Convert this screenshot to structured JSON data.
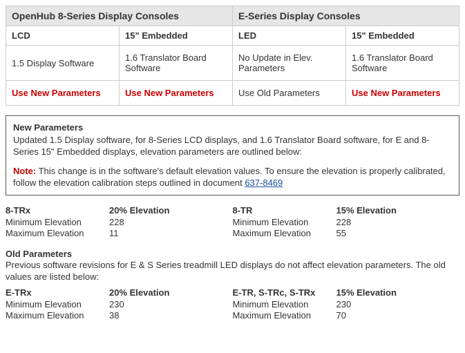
{
  "table": {
    "groupHeaders": [
      "OpenHub 8-Series Display Consoles",
      "E-Series Display Consoles"
    ],
    "subHeaders": [
      "LCD",
      "15\" Embedded",
      "LED",
      "15\" Embedded"
    ],
    "row1": [
      "1.5 Display Software",
      "1.6 Translator Board Software",
      "No Update in Elev. Parameters",
      "1.6 Translator Board Software"
    ],
    "row2": [
      "Use New Parameters",
      "Use New Parameters",
      "Use Old Parameters",
      "Use New Parameters"
    ],
    "row2Red": [
      true,
      true,
      false,
      true
    ]
  },
  "noteBox": {
    "title": "New Parameters",
    "body": "Updated 1.5 Display software, for 8-Series LCD displays, and 1.6 Translator Board software, for E and 8-Series 15\" Embedded displays, elevation parameters are outlined below:",
    "noteLabel": "Note:",
    "noteText": " This change is in the software's default elevation values. To ensure the elevation is properly calibrated, follow the elevation calibration steps outlined in document ",
    "link": "637-8469"
  },
  "newParams": {
    "left": {
      "name": "8-TRx",
      "elev": "20% Elevation",
      "minLabel": "Minimum Elevation",
      "minVal": "228",
      "maxLabel": "Maximum Elevation",
      "maxVal": "11"
    },
    "right": {
      "name": "8-TR",
      "elev": "15% Elevation",
      "minLabel": "Minimum Elevation",
      "minVal": "228",
      "maxLabel": "Maximum Elevation",
      "maxVal": "55"
    }
  },
  "oldSection": {
    "title": "Old Parameters",
    "desc": "Previous software revisions for E & S Series treadmill LED displays do not affect elevation parameters.  The old values are listed below:"
  },
  "oldParams": {
    "left": {
      "name": "E-TRx",
      "elev": "20% Elevation",
      "minLabel": "Minimum Elevation",
      "minVal": "230",
      "maxLabel": "Maximum Elevation",
      "maxVal": "38"
    },
    "right": {
      "name": "E-TR, S-TRc, S-TRx",
      "elev": "15% Elevation",
      "minLabel": "Minimum Elevation",
      "minVal": "230",
      "maxLabel": "Maximum Elevation",
      "maxVal": "70"
    }
  }
}
